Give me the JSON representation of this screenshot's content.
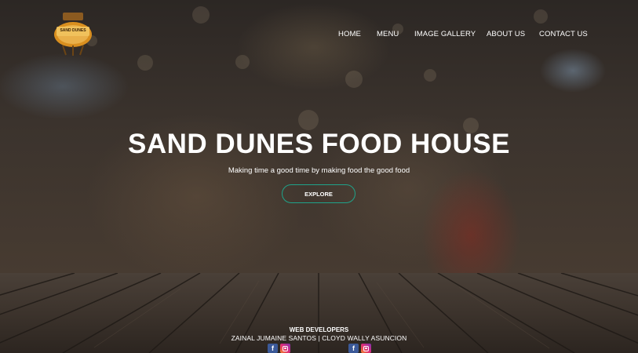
{
  "brand": {
    "logo_text": "SAND DUNES"
  },
  "nav": {
    "items": [
      {
        "label": "HOME"
      },
      {
        "label": "MENU"
      },
      {
        "label": "IMAGE GALLERY"
      },
      {
        "label": "ABOUT US"
      },
      {
        "label": "CONTACT US"
      }
    ]
  },
  "hero": {
    "title": "SAND DUNES FOOD HOUSE",
    "tagline": "Making time a good time by making food the good food",
    "cta_label": "EXPLORE"
  },
  "footer": {
    "heading": "WEB DEVELOPERS",
    "names": "ZAINAL JUMAINE SANTOS | CLOYD WALLY ASUNCION",
    "social_icons": [
      "facebook-icon",
      "instagram-icon",
      "facebook-icon",
      "instagram-icon"
    ],
    "facebook_glyph": "f"
  },
  "colors": {
    "accent": "#1fa38a",
    "facebook": "#3b5998"
  }
}
